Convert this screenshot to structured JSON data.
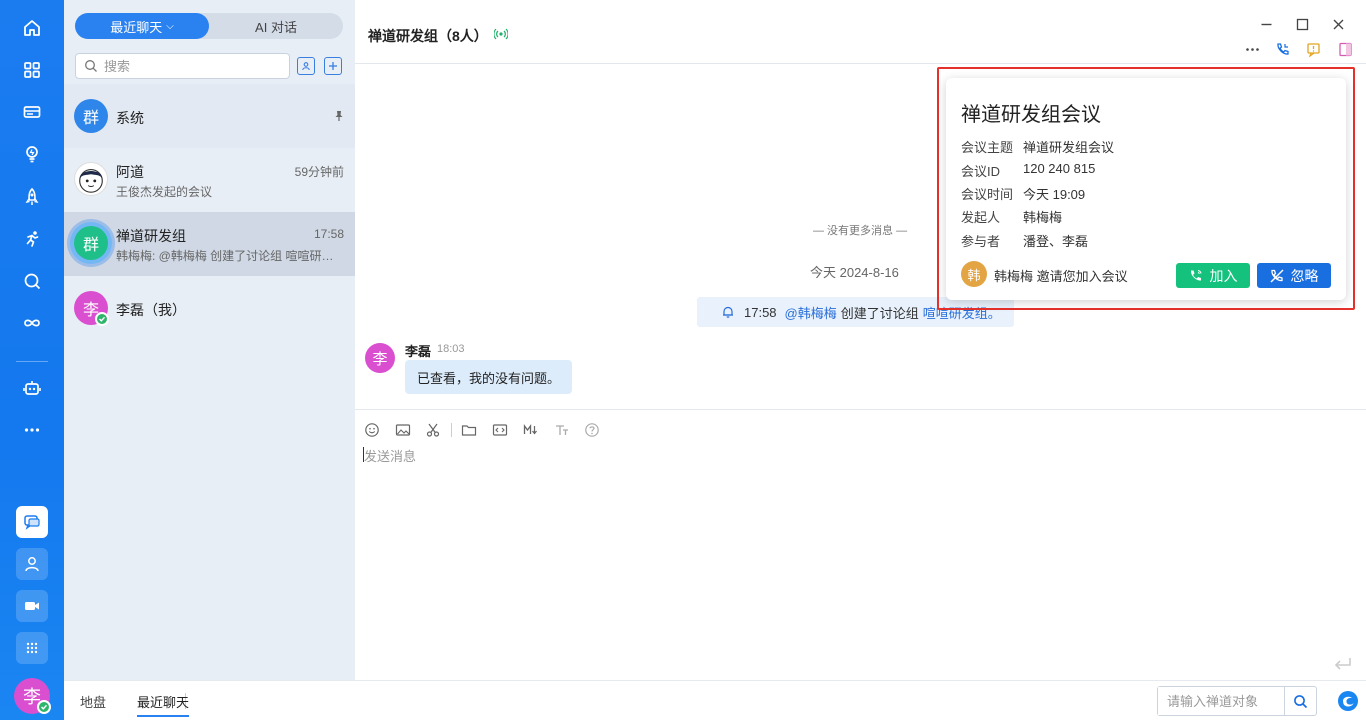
{
  "sidebar": {
    "tabs": [
      "最近聊天",
      "AI 对话"
    ],
    "search_placeholder": "搜索",
    "chats": [
      {
        "name": "系统",
        "avatar": "群",
        "avatar_color": "#2e86ea",
        "time": "",
        "preview": "",
        "pinned": true
      },
      {
        "name": "阿道",
        "avatar": "",
        "avatar_color": "#ffffff",
        "time": "59分钟前",
        "preview": "王俊杰发起的会议"
      },
      {
        "name": "禅道研发组",
        "avatar": "群",
        "avatar_color": "#1fbf8a",
        "time": "17:58",
        "preview": "韩梅梅: @韩梅梅 创建了讨论组 喧喧研发组。",
        "selected": true
      },
      {
        "name": "李磊（我）",
        "avatar": "李",
        "avatar_color": "#d94fd0",
        "time": "",
        "preview": ""
      }
    ]
  },
  "rail": {
    "user_avatar": "李"
  },
  "header": {
    "title": "禅道研发组（8人）"
  },
  "messages": {
    "no_more": "— 没有更多消息 —",
    "date": "今天 2024-8-16",
    "system_notice": {
      "time": "17:58",
      "mention": "@韩梅梅",
      "text": "创建了讨论组",
      "group": "喧喧研发组。"
    },
    "items": [
      {
        "sender": "李磊",
        "avatar": "李",
        "time": "18:03",
        "text": "已查看，我的没有问题。"
      }
    ]
  },
  "composer": {
    "placeholder": "发送消息"
  },
  "meeting_popup": {
    "title": "禅道研发组会议",
    "rows": [
      {
        "key": "会议主题",
        "value": "禅道研发组会议"
      },
      {
        "key": "会议ID",
        "value": "120 240 815"
      },
      {
        "key": "会议时间",
        "value": "今天 19:09"
      },
      {
        "key": "发起人",
        "value": "韩梅梅"
      },
      {
        "key": "参与者",
        "value": "潘登、李磊"
      }
    ],
    "inviter_avatar": "韩",
    "inviter_text": "韩梅梅 邀请您加入会议",
    "join_label": "加入",
    "ignore_label": "忽略"
  },
  "bottombar": {
    "tabs": [
      "地盘",
      "最近聊天"
    ],
    "search_placeholder": "请输入禅道对象"
  },
  "colors": {
    "accent": "#2a82f0",
    "join": "#14c27e",
    "ignore": "#1a6fe0",
    "highlight": "#e5302b"
  }
}
